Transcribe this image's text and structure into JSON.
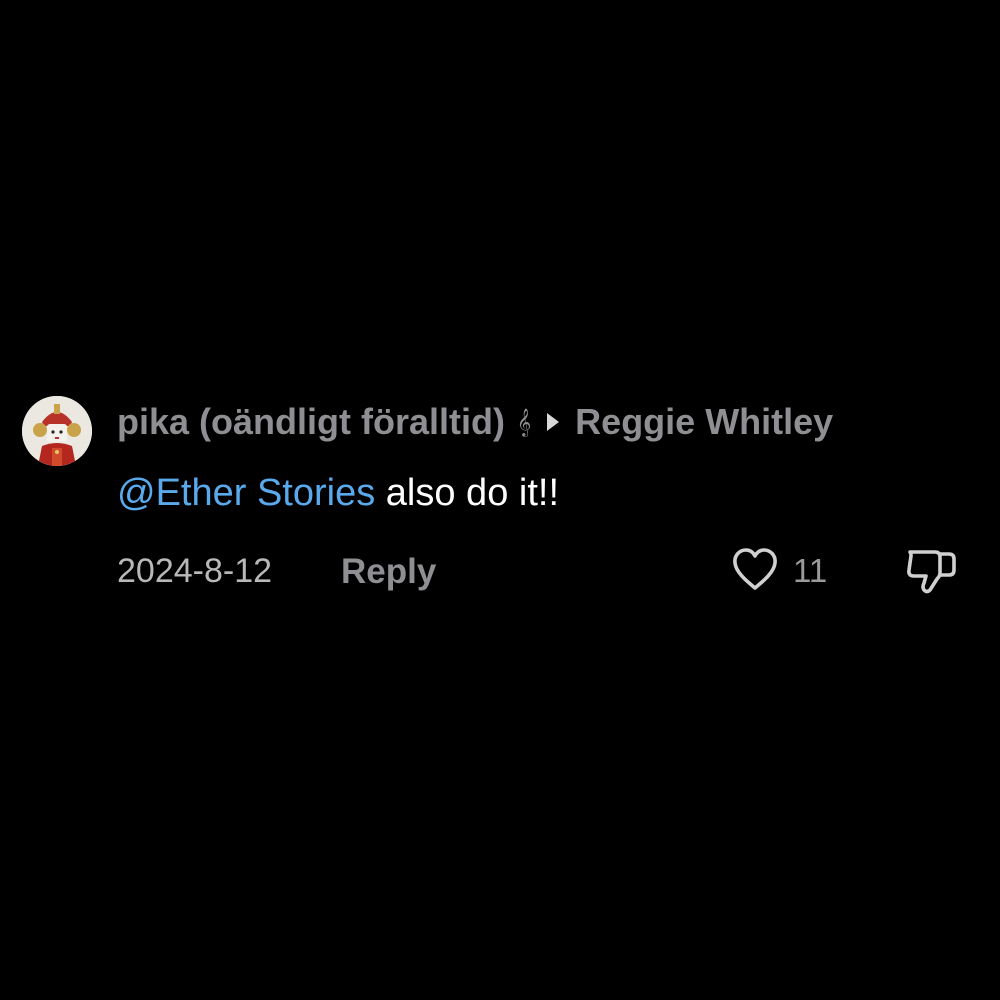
{
  "comment": {
    "author_name": "pika (oändligt föralltid)",
    "author_emoji": "𝄞",
    "reply_to_name": "Reggie Whitley",
    "mention": "@Ether Stories",
    "text": " also do it!!",
    "date": "2024-8-12",
    "reply_label": "Reply",
    "like_count": "11"
  },
  "colors": {
    "background": "#000000",
    "mention": "#5aa9ec",
    "muted_text": "#8f8f93",
    "body_text": "#ffffff"
  },
  "icons": {
    "avatar": "avatar-image",
    "arrow": "reply-arrow-icon",
    "like": "heart-outline-icon",
    "dislike": "thumbs-down-outline-icon"
  }
}
